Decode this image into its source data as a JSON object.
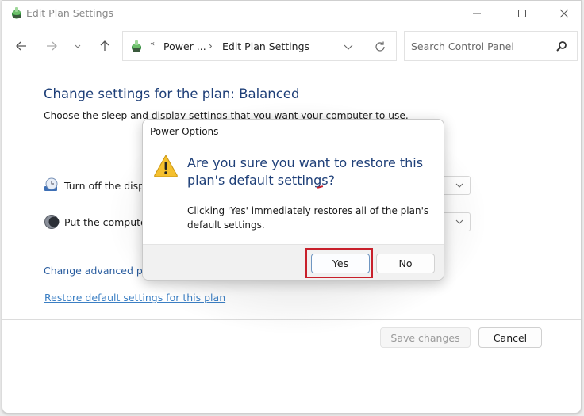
{
  "window": {
    "title": "Edit Plan Settings",
    "controls": {
      "minimize": "minimize-icon",
      "maximize": "maximize-icon",
      "close": "close-icon"
    }
  },
  "navigation": {
    "back": "arrow-left-icon",
    "forward": "arrow-right-icon",
    "recent": "chevron-down-icon",
    "up": "arrow-up-icon"
  },
  "address_bar": {
    "overflow": "«",
    "segments": [
      "Power ...",
      "Edit Plan Settings"
    ],
    "separator": "›"
  },
  "search": {
    "placeholder": "Search Control Panel"
  },
  "content": {
    "heading": "Change settings for the plan: Balanced",
    "subtext": "Choose the sleep and display settings that you want your computer to use.",
    "rows": [
      {
        "label": "Turn off the display:",
        "icon": "monitor-clock-icon"
      },
      {
        "label": "Put the computer to sleep:",
        "icon": "moon-icon"
      }
    ],
    "links": {
      "advanced": "Change advanced power settings",
      "restore": "Restore default settings for this plan"
    },
    "buttons": {
      "save": "Save changes",
      "cancel": "Cancel"
    }
  },
  "dialog": {
    "title": "Power Options",
    "icon": "warning-icon",
    "main_instruction": "Are you sure you want to restore this plan's default settings?",
    "body": "Clicking 'Yes' immediately restores all of the plan's default settings.",
    "buttons": {
      "yes": "Yes",
      "no": "No"
    },
    "highlight_color": "#c8202b"
  },
  "colors": {
    "heading": "#1e3f78",
    "link": "#2a5d9f",
    "accent_border": "#6f96c2"
  }
}
